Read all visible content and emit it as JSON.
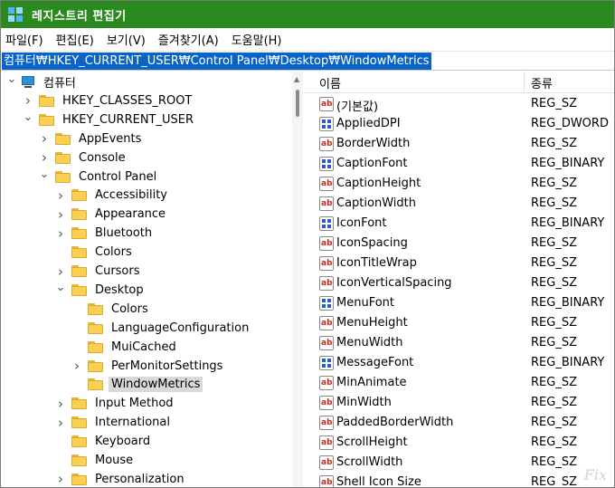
{
  "window": {
    "title": "레지스트리 편집기"
  },
  "menu": [
    "파일(F)",
    "편집(E)",
    "보기(V)",
    "즐겨찾기(A)",
    "도움말(H)"
  ],
  "address": "컴퓨터₩HKEY_CURRENT_USER₩Control Panel₩Desktop₩WindowMetrics",
  "tree": [
    {
      "label": "컴퓨터",
      "depth": 0,
      "expander": "expanded",
      "icon": "computer-icon"
    },
    {
      "label": "HKEY_CLASSES_ROOT",
      "depth": 1,
      "expander": "collapsed",
      "icon": "folder-icon"
    },
    {
      "label": "HKEY_CURRENT_USER",
      "depth": 1,
      "expander": "expanded",
      "icon": "folder-icon"
    },
    {
      "label": "AppEvents",
      "depth": 2,
      "expander": "collapsed",
      "icon": "folder-icon"
    },
    {
      "label": "Console",
      "depth": 2,
      "expander": "collapsed",
      "icon": "folder-icon"
    },
    {
      "label": "Control Panel",
      "depth": 2,
      "expander": "expanded",
      "icon": "folder-icon"
    },
    {
      "label": "Accessibility",
      "depth": 3,
      "expander": "collapsed",
      "icon": "folder-icon"
    },
    {
      "label": "Appearance",
      "depth": 3,
      "expander": "collapsed",
      "icon": "folder-icon"
    },
    {
      "label": "Bluetooth",
      "depth": 3,
      "expander": "collapsed",
      "icon": "folder-icon"
    },
    {
      "label": "Colors",
      "depth": 3,
      "expander": "none",
      "icon": "folder-icon"
    },
    {
      "label": "Cursors",
      "depth": 3,
      "expander": "collapsed",
      "icon": "folder-icon"
    },
    {
      "label": "Desktop",
      "depth": 3,
      "expander": "expanded",
      "icon": "folder-icon"
    },
    {
      "label": "Colors",
      "depth": 4,
      "expander": "none",
      "icon": "folder-icon"
    },
    {
      "label": "LanguageConfiguration",
      "depth": 4,
      "expander": "none",
      "icon": "folder-icon"
    },
    {
      "label": "MuiCached",
      "depth": 4,
      "expander": "none",
      "icon": "folder-icon"
    },
    {
      "label": "PerMonitorSettings",
      "depth": 4,
      "expander": "collapsed",
      "icon": "folder-icon"
    },
    {
      "label": "WindowMetrics",
      "depth": 4,
      "expander": "none",
      "icon": "folder-icon",
      "selected": true
    },
    {
      "label": "Input Method",
      "depth": 3,
      "expander": "collapsed",
      "icon": "folder-icon"
    },
    {
      "label": "International",
      "depth": 3,
      "expander": "collapsed",
      "icon": "folder-icon"
    },
    {
      "label": "Keyboard",
      "depth": 3,
      "expander": "none",
      "icon": "folder-icon"
    },
    {
      "label": "Mouse",
      "depth": 3,
      "expander": "none",
      "icon": "folder-icon"
    },
    {
      "label": "Personalization",
      "depth": 3,
      "expander": "collapsed",
      "icon": "folder-icon"
    }
  ],
  "list": {
    "headers": {
      "name": "이름",
      "type": "종류"
    },
    "rows": [
      {
        "name": "(기본값)",
        "type": "REG_SZ"
      },
      {
        "name": "AppliedDPI",
        "type": "REG_DWORD"
      },
      {
        "name": "BorderWidth",
        "type": "REG_SZ"
      },
      {
        "name": "CaptionFont",
        "type": "REG_BINARY"
      },
      {
        "name": "CaptionHeight",
        "type": "REG_SZ"
      },
      {
        "name": "CaptionWidth",
        "type": "REG_SZ"
      },
      {
        "name": "IconFont",
        "type": "REG_BINARY"
      },
      {
        "name": "IconSpacing",
        "type": "REG_SZ"
      },
      {
        "name": "IconTitleWrap",
        "type": "REG_SZ"
      },
      {
        "name": "IconVerticalSpacing",
        "type": "REG_SZ"
      },
      {
        "name": "MenuFont",
        "type": "REG_BINARY"
      },
      {
        "name": "MenuHeight",
        "type": "REG_SZ"
      },
      {
        "name": "MenuWidth",
        "type": "REG_SZ"
      },
      {
        "name": "MessageFont",
        "type": "REG_BINARY"
      },
      {
        "name": "MinAnimate",
        "type": "REG_SZ"
      },
      {
        "name": "MinWidth",
        "type": "REG_SZ"
      },
      {
        "name": "PaddedBorderWidth",
        "type": "REG_SZ"
      },
      {
        "name": "ScrollHeight",
        "type": "REG_SZ"
      },
      {
        "name": "ScrollWidth",
        "type": "REG_SZ"
      },
      {
        "name": "Shell Icon Size",
        "type": "REG_SZ"
      }
    ]
  },
  "watermark": "Fix",
  "colors": {
    "titlebar": "#2a8a1f",
    "address_highlight": "#0a64c8",
    "selection": "#d9d9d9"
  }
}
